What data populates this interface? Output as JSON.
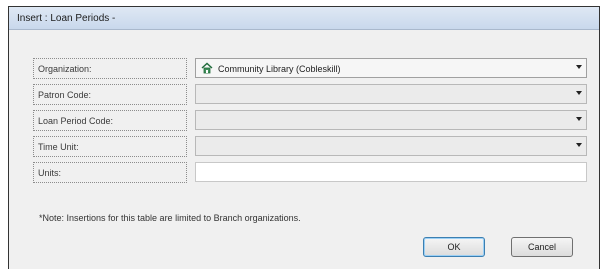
{
  "window": {
    "title": "Insert : Loan Periods -"
  },
  "form": {
    "organization": {
      "label": "Organization:",
      "value": "Community Library (Cobleskill)"
    },
    "patron_code": {
      "label": "Patron Code:",
      "value": ""
    },
    "loan_period_code": {
      "label": "Loan Period Code:",
      "value": ""
    },
    "time_unit": {
      "label": "Time Unit:",
      "value": ""
    },
    "units": {
      "label": "Units:",
      "value": ""
    }
  },
  "note": "*Note: Insertions for this table are limited to Branch organizations.",
  "buttons": {
    "ok": "OK",
    "cancel": "Cancel"
  },
  "icons": {
    "organization": "house-icon",
    "dropdown": "chevron-down-icon"
  }
}
